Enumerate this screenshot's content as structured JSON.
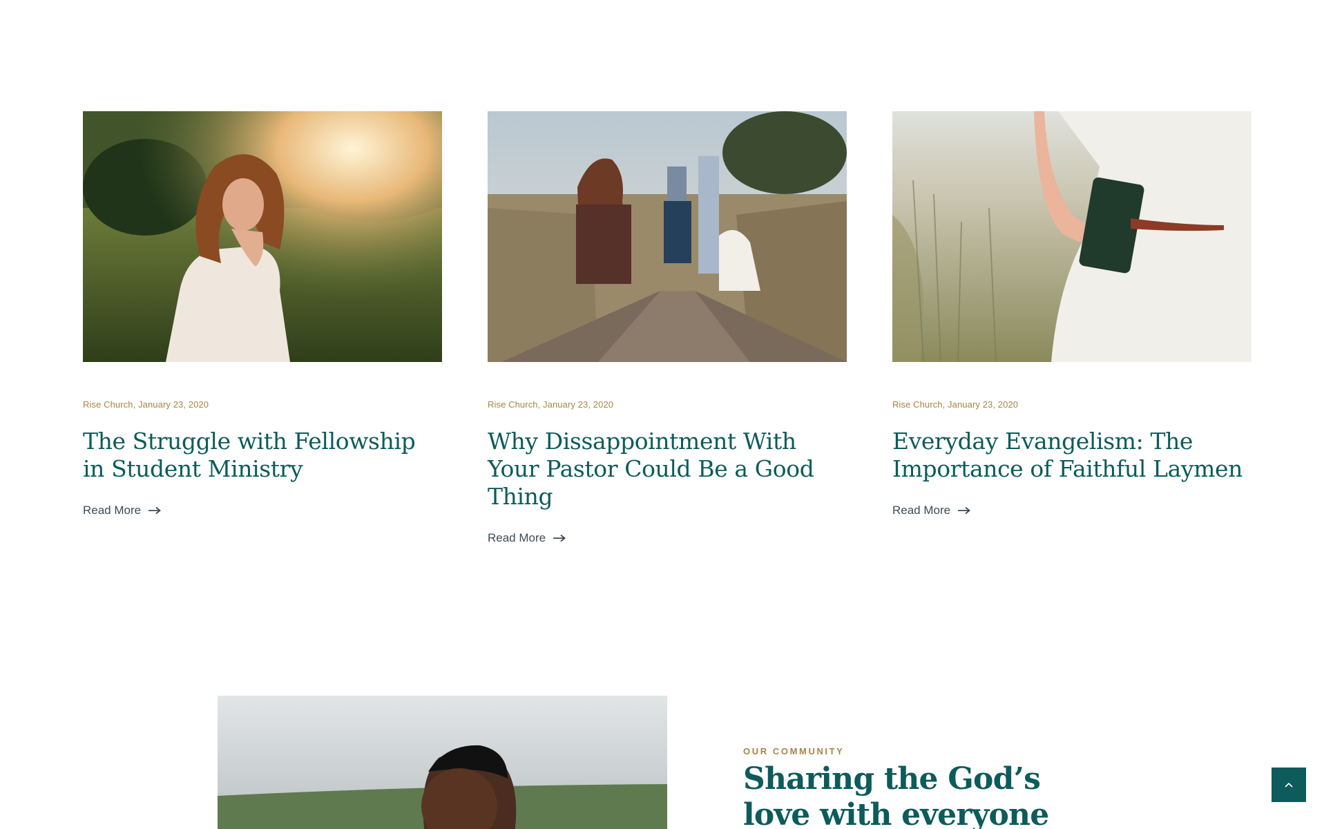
{
  "posts": [
    {
      "meta": "Rise Church, January 23, 2020",
      "title": "The Struggle with Fellowship in Student Ministry",
      "read_more": "Read More",
      "image": "woman-praying-in-sunlit-field"
    },
    {
      "meta": "Rise Church, January 23, 2020",
      "title": "Why Dissappointment With Your Pastor Could Be a Good Thing",
      "read_more": "Read More",
      "image": "family-walking-on-boardwalk"
    },
    {
      "meta": "Rise Church, January 23, 2020",
      "title": "Everyday Evangelism: The Importance of Faithful Laymen",
      "read_more": "Read More",
      "image": "woman-holding-bible-in-meadow"
    }
  ],
  "community": {
    "eyebrow": "OUR COMMUNITY",
    "title": "Sharing the God’s love with everyone",
    "image": "man-praying-outdoors"
  },
  "icons": {
    "read_more": "arrow-right-icon",
    "back_to_top": "chevron-up-icon"
  },
  "colors": {
    "accent": "#0d5b5b",
    "meta": "#a88446",
    "text": "#3d4a57"
  }
}
